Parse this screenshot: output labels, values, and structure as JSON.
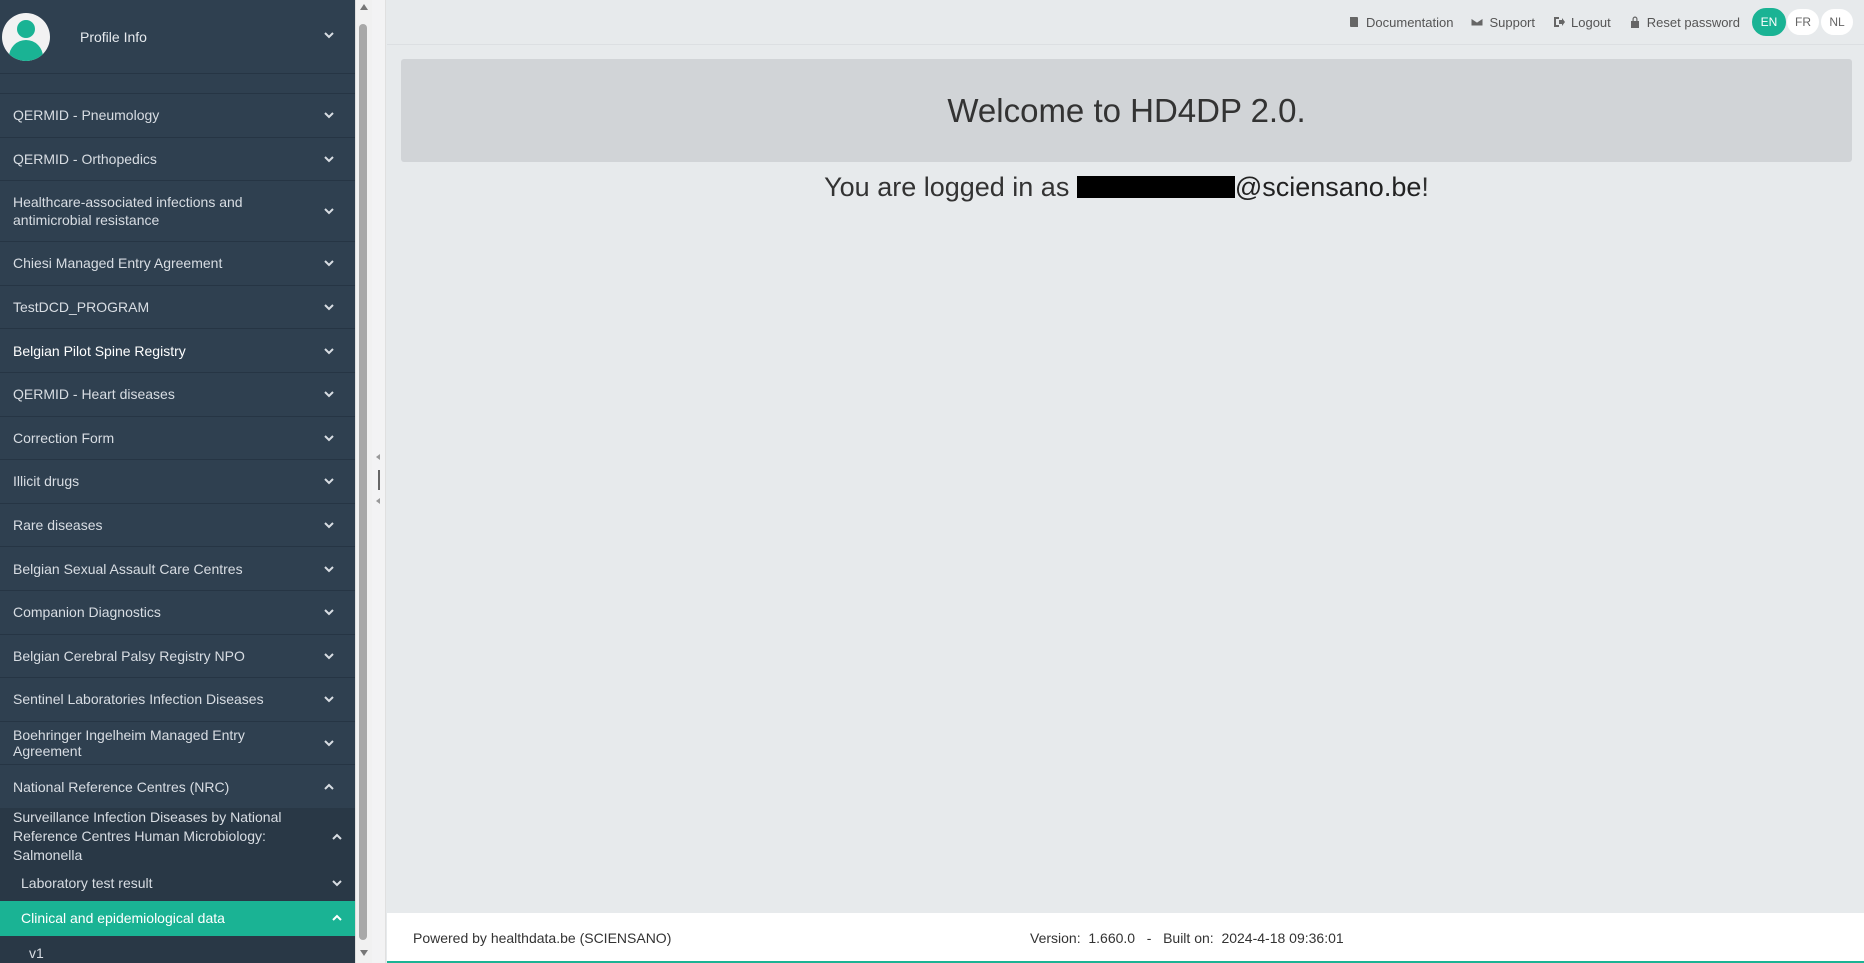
{
  "sidebar": {
    "profile_label": "Profile Info",
    "items": [
      {
        "label": "QERMID - Pneumology"
      },
      {
        "label": "QERMID - Orthopedics"
      },
      {
        "label": "Healthcare-associated infections and antimicrobial resistance"
      },
      {
        "label": "Chiesi Managed Entry Agreement"
      },
      {
        "label": "TestDCD_PROGRAM"
      },
      {
        "label": "Belgian Pilot Spine Registry"
      },
      {
        "label": "QERMID - Heart diseases"
      },
      {
        "label": "Correction Form"
      },
      {
        "label": "Illicit drugs"
      },
      {
        "label": "Rare diseases"
      },
      {
        "label": "Belgian Sexual Assault Care Centres"
      },
      {
        "label": "Companion Diagnostics"
      },
      {
        "label": "Belgian Cerebral Palsy Registry NPO"
      },
      {
        "label": "Sentinel Laboratories Infection Diseases"
      },
      {
        "label": "Boehringer Ingelheim Managed Entry Agreement"
      },
      {
        "label": "National Reference Centres (NRC)"
      }
    ],
    "sub1": "Surveillance Infection Diseases by National Reference Centres Human Microbiology: Salmonella",
    "sub2": "Laboratory test result",
    "sub3_active": "Clinical and epidemiological data",
    "sub4": "v1"
  },
  "topbar": {
    "documentation": "Documentation",
    "support": "Support",
    "logout": "Logout",
    "reset_password": "Reset password",
    "languages": [
      "EN",
      "FR",
      "NL"
    ],
    "active_language": "EN"
  },
  "main": {
    "welcome": "Welcome to HD4DP 2.0.",
    "logged_in_prefix": "You are logged in as ",
    "email_domain": "@sciensano.be",
    "logged_in_suffix": "!"
  },
  "footer": {
    "powered_by": "Powered by healthdata.be (SCIENSANO)",
    "version": "Version:  1.660.0   -   Built on:  2024-4-18 09:36:01"
  },
  "colors": {
    "sidebar_bg": "#2f4050",
    "accent": "#1ab394"
  }
}
